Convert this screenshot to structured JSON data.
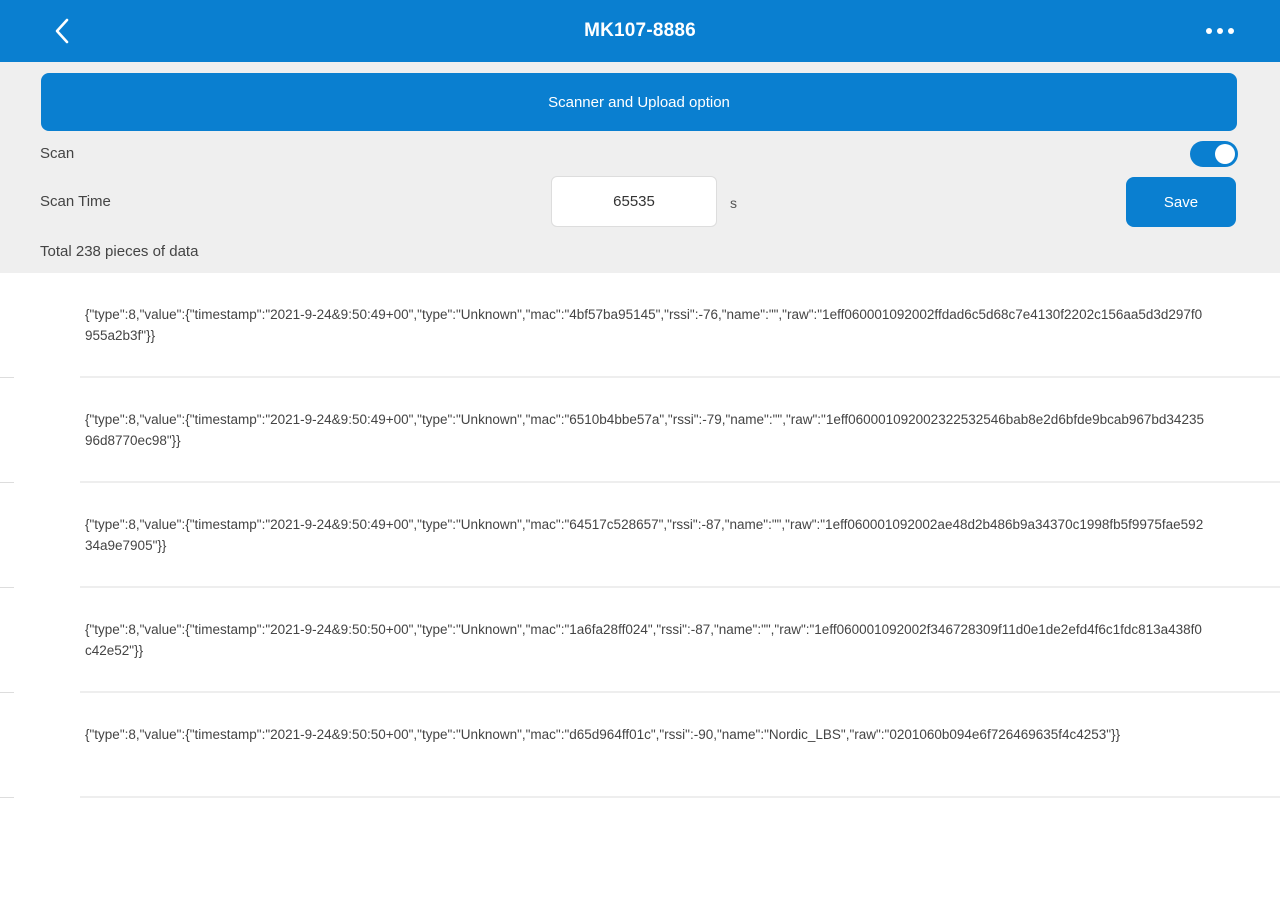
{
  "header": {
    "title": "MK107-8886",
    "back_icon": "chevron-left-icon",
    "more_icon": "more-horizontal-icon",
    "color": "#0a7fd0"
  },
  "config": {
    "upload_button_label": "Scanner and Upload option",
    "scan_label": "Scan",
    "scan_enabled": true,
    "scan_time_label": "Scan Time",
    "scan_time_value": "65535",
    "scan_time_unit": "s",
    "save_label": "Save",
    "total_text": "Total 238 pieces of data"
  },
  "records": [
    {
      "text": "{\"type\":8,\"value\":{\"timestamp\":\"2021-9-24&9:50:49+00\",\"type\":\"Unknown\",\"mac\":\"4bf57ba95145\",\"rssi\":-76,\"name\":\"\",\"raw\":\"1eff060001092002ffdad6c5d68c7e4130f2202c156aa5d3d297f0955a2b3f\"}}"
    },
    {
      "text": "{\"type\":8,\"value\":{\"timestamp\":\"2021-9-24&9:50:49+00\",\"type\":\"Unknown\",\"mac\":\"6510b4bbe57a\",\"rssi\":-79,\"name\":\"\",\"raw\":\"1eff060001092002322532546bab8e2d6bfde9bcab967bd3423596d8770ec98\"}}"
    },
    {
      "text": "{\"type\":8,\"value\":{\"timestamp\":\"2021-9-24&9:50:49+00\",\"type\":\"Unknown\",\"mac\":\"64517c528657\",\"rssi\":-87,\"name\":\"\",\"raw\":\"1eff060001092002ae48d2b486b9a34370c1998fb5f9975fae59234a9e7905\"}}"
    },
    {
      "text": "{\"type\":8,\"value\":{\"timestamp\":\"2021-9-24&9:50:50+00\",\"type\":\"Unknown\",\"mac\":\"1a6fa28ff024\",\"rssi\":-87,\"name\":\"\",\"raw\":\"1eff060001092002f346728309f11d0e1de2efd4f6c1fdc813a438f0c42e52\"}}"
    },
    {
      "text": "{\"type\":8,\"value\":{\"timestamp\":\"2021-9-24&9:50:50+00\",\"type\":\"Unknown\",\"mac\":\"d65d964ff01c\",\"rssi\":-90,\"name\":\"Nordic_LBS\",\"raw\":\"0201060b094e6f726469635f4c4253\"}}"
    }
  ]
}
